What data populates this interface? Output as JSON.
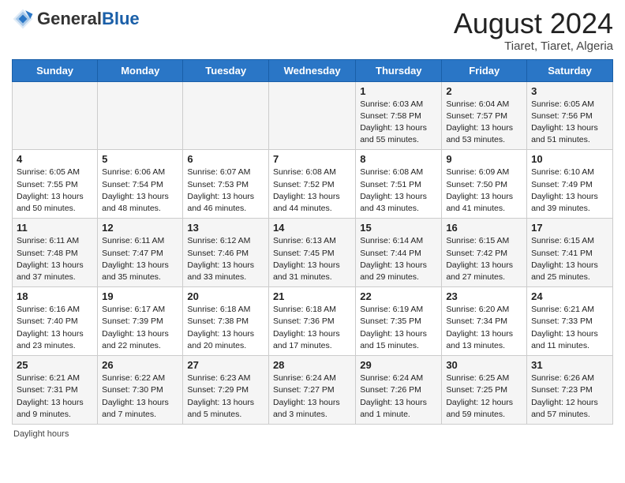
{
  "header": {
    "logo_general": "General",
    "logo_blue": "Blue",
    "month_year": "August 2024",
    "location": "Tiaret, Tiaret, Algeria"
  },
  "columns": [
    "Sunday",
    "Monday",
    "Tuesday",
    "Wednesday",
    "Thursday",
    "Friday",
    "Saturday"
  ],
  "weeks": [
    [
      {
        "day": "",
        "info": ""
      },
      {
        "day": "",
        "info": ""
      },
      {
        "day": "",
        "info": ""
      },
      {
        "day": "",
        "info": ""
      },
      {
        "day": "1",
        "info": "Sunrise: 6:03 AM\nSunset: 7:58 PM\nDaylight: 13 hours and 55 minutes."
      },
      {
        "day": "2",
        "info": "Sunrise: 6:04 AM\nSunset: 7:57 PM\nDaylight: 13 hours and 53 minutes."
      },
      {
        "day": "3",
        "info": "Sunrise: 6:05 AM\nSunset: 7:56 PM\nDaylight: 13 hours and 51 minutes."
      }
    ],
    [
      {
        "day": "4",
        "info": "Sunrise: 6:05 AM\nSunset: 7:55 PM\nDaylight: 13 hours and 50 minutes."
      },
      {
        "day": "5",
        "info": "Sunrise: 6:06 AM\nSunset: 7:54 PM\nDaylight: 13 hours and 48 minutes."
      },
      {
        "day": "6",
        "info": "Sunrise: 6:07 AM\nSunset: 7:53 PM\nDaylight: 13 hours and 46 minutes."
      },
      {
        "day": "7",
        "info": "Sunrise: 6:08 AM\nSunset: 7:52 PM\nDaylight: 13 hours and 44 minutes."
      },
      {
        "day": "8",
        "info": "Sunrise: 6:08 AM\nSunset: 7:51 PM\nDaylight: 13 hours and 43 minutes."
      },
      {
        "day": "9",
        "info": "Sunrise: 6:09 AM\nSunset: 7:50 PM\nDaylight: 13 hours and 41 minutes."
      },
      {
        "day": "10",
        "info": "Sunrise: 6:10 AM\nSunset: 7:49 PM\nDaylight: 13 hours and 39 minutes."
      }
    ],
    [
      {
        "day": "11",
        "info": "Sunrise: 6:11 AM\nSunset: 7:48 PM\nDaylight: 13 hours and 37 minutes."
      },
      {
        "day": "12",
        "info": "Sunrise: 6:11 AM\nSunset: 7:47 PM\nDaylight: 13 hours and 35 minutes."
      },
      {
        "day": "13",
        "info": "Sunrise: 6:12 AM\nSunset: 7:46 PM\nDaylight: 13 hours and 33 minutes."
      },
      {
        "day": "14",
        "info": "Sunrise: 6:13 AM\nSunset: 7:45 PM\nDaylight: 13 hours and 31 minutes."
      },
      {
        "day": "15",
        "info": "Sunrise: 6:14 AM\nSunset: 7:44 PM\nDaylight: 13 hours and 29 minutes."
      },
      {
        "day": "16",
        "info": "Sunrise: 6:15 AM\nSunset: 7:42 PM\nDaylight: 13 hours and 27 minutes."
      },
      {
        "day": "17",
        "info": "Sunrise: 6:15 AM\nSunset: 7:41 PM\nDaylight: 13 hours and 25 minutes."
      }
    ],
    [
      {
        "day": "18",
        "info": "Sunrise: 6:16 AM\nSunset: 7:40 PM\nDaylight: 13 hours and 23 minutes."
      },
      {
        "day": "19",
        "info": "Sunrise: 6:17 AM\nSunset: 7:39 PM\nDaylight: 13 hours and 22 minutes."
      },
      {
        "day": "20",
        "info": "Sunrise: 6:18 AM\nSunset: 7:38 PM\nDaylight: 13 hours and 20 minutes."
      },
      {
        "day": "21",
        "info": "Sunrise: 6:18 AM\nSunset: 7:36 PM\nDaylight: 13 hours and 17 minutes."
      },
      {
        "day": "22",
        "info": "Sunrise: 6:19 AM\nSunset: 7:35 PM\nDaylight: 13 hours and 15 minutes."
      },
      {
        "day": "23",
        "info": "Sunrise: 6:20 AM\nSunset: 7:34 PM\nDaylight: 13 hours and 13 minutes."
      },
      {
        "day": "24",
        "info": "Sunrise: 6:21 AM\nSunset: 7:33 PM\nDaylight: 13 hours and 11 minutes."
      }
    ],
    [
      {
        "day": "25",
        "info": "Sunrise: 6:21 AM\nSunset: 7:31 PM\nDaylight: 13 hours and 9 minutes."
      },
      {
        "day": "26",
        "info": "Sunrise: 6:22 AM\nSunset: 7:30 PM\nDaylight: 13 hours and 7 minutes."
      },
      {
        "day": "27",
        "info": "Sunrise: 6:23 AM\nSunset: 7:29 PM\nDaylight: 13 hours and 5 minutes."
      },
      {
        "day": "28",
        "info": "Sunrise: 6:24 AM\nSunset: 7:27 PM\nDaylight: 13 hours and 3 minutes."
      },
      {
        "day": "29",
        "info": "Sunrise: 6:24 AM\nSunset: 7:26 PM\nDaylight: 13 hours and 1 minute."
      },
      {
        "day": "30",
        "info": "Sunrise: 6:25 AM\nSunset: 7:25 PM\nDaylight: 12 hours and 59 minutes."
      },
      {
        "day": "31",
        "info": "Sunrise: 6:26 AM\nSunset: 7:23 PM\nDaylight: 12 hours and 57 minutes."
      }
    ]
  ],
  "footer": {
    "daylight_label": "Daylight hours"
  }
}
